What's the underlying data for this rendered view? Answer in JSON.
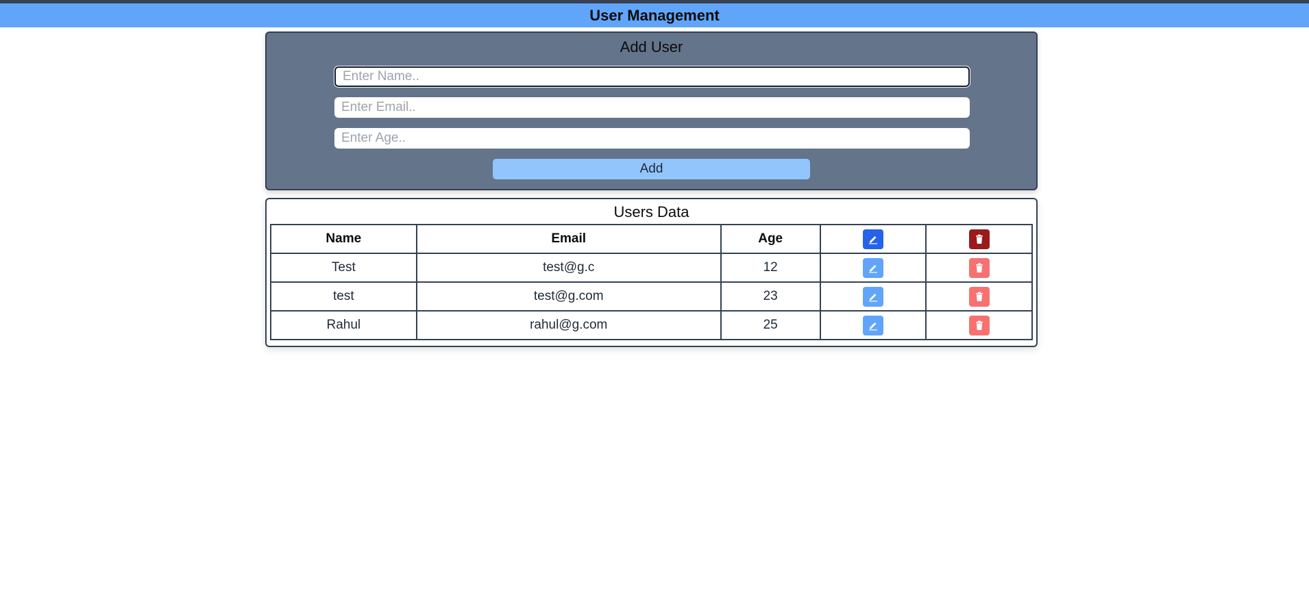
{
  "header": {
    "title": "User Management"
  },
  "add_user": {
    "title": "Add User",
    "name_placeholder": "Enter Name..",
    "email_placeholder": "Enter Email..",
    "age_placeholder": "Enter Age..",
    "name_value": "",
    "email_value": "",
    "age_value": "",
    "add_label": "Add"
  },
  "users_table": {
    "title": "Users Data",
    "columns": [
      "Name",
      "Email",
      "Age"
    ],
    "edit_icon": "pencil-icon",
    "delete_icon": "trash-icon",
    "rows": [
      {
        "name": "Test",
        "email": "test@g.c",
        "age": "12"
      },
      {
        "name": "test",
        "email": "test@g.com",
        "age": "23"
      },
      {
        "name": "Rahul",
        "email": "rahul@g.com",
        "age": "25"
      }
    ]
  },
  "colors": {
    "header_bg": "#60a5fa",
    "card_bg": "#64748b",
    "add_button": "#93c5fd",
    "edit_header": "#2563eb",
    "delete_header": "#991b1b",
    "edit_row": "#60a5fa",
    "delete_row": "#f87171"
  }
}
